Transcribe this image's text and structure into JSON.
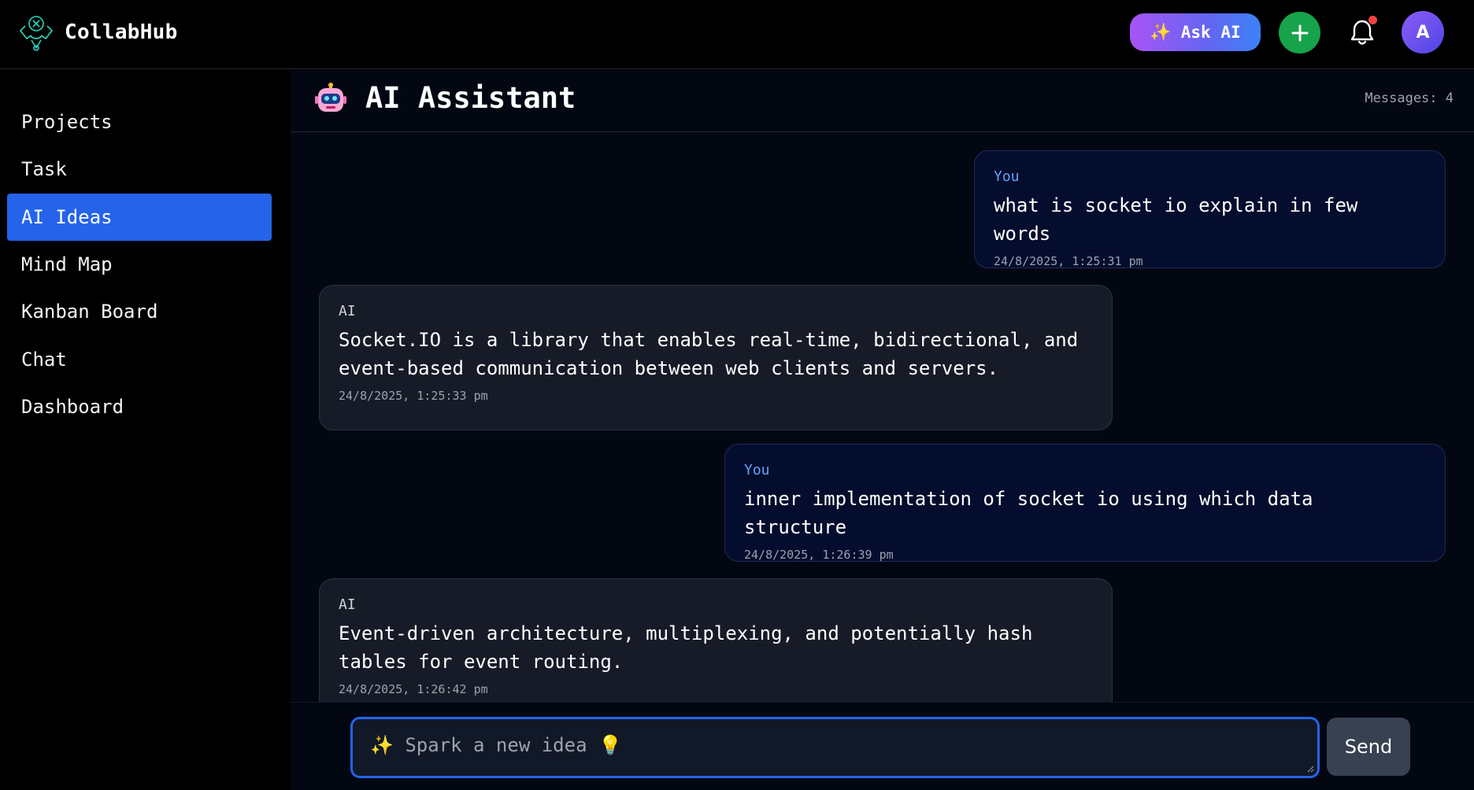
{
  "app": {
    "name": "CollabHub",
    "ask_ai_label": "Ask AI",
    "avatar_initial": "A"
  },
  "sidebar": {
    "items": [
      {
        "label": "Projects",
        "active": false
      },
      {
        "label": "Task",
        "active": false
      },
      {
        "label": "AI Ideas",
        "active": true
      },
      {
        "label": "Mind Map",
        "active": false
      },
      {
        "label": "Kanban Board",
        "active": false
      },
      {
        "label": "Chat",
        "active": false
      },
      {
        "label": "Dashboard",
        "active": false
      }
    ]
  },
  "chat": {
    "title": "AI Assistant",
    "message_count": "Messages: 4",
    "messages": [
      {
        "sender": "You",
        "text": "what is socket io explain in few words",
        "timestamp": "24/8/2025, 1:25:31 pm"
      },
      {
        "sender": "AI",
        "text": "Socket.IO is a library that enables real-time, bidirectional, and event-based communication between web clients and servers.",
        "timestamp": "24/8/2025, 1:25:33 pm"
      },
      {
        "sender": "You",
        "text": "inner implementation of socket io using which data structure",
        "timestamp": "24/8/2025, 1:26:39 pm"
      },
      {
        "sender": "AI",
        "text": "Event-driven architecture, multiplexing, and potentially hash tables for event routing.",
        "timestamp": "24/8/2025, 1:26:42 pm"
      }
    ],
    "input_placeholder": "✨ Spark a new idea 💡",
    "send_label": "Send"
  },
  "colors": {
    "accent": "#2563eb",
    "ask_ai_gradient_start": "#a855f7",
    "ask_ai_gradient_end": "#3b82f6",
    "add_button": "#16a34a",
    "notification_dot": "#ef4444"
  }
}
